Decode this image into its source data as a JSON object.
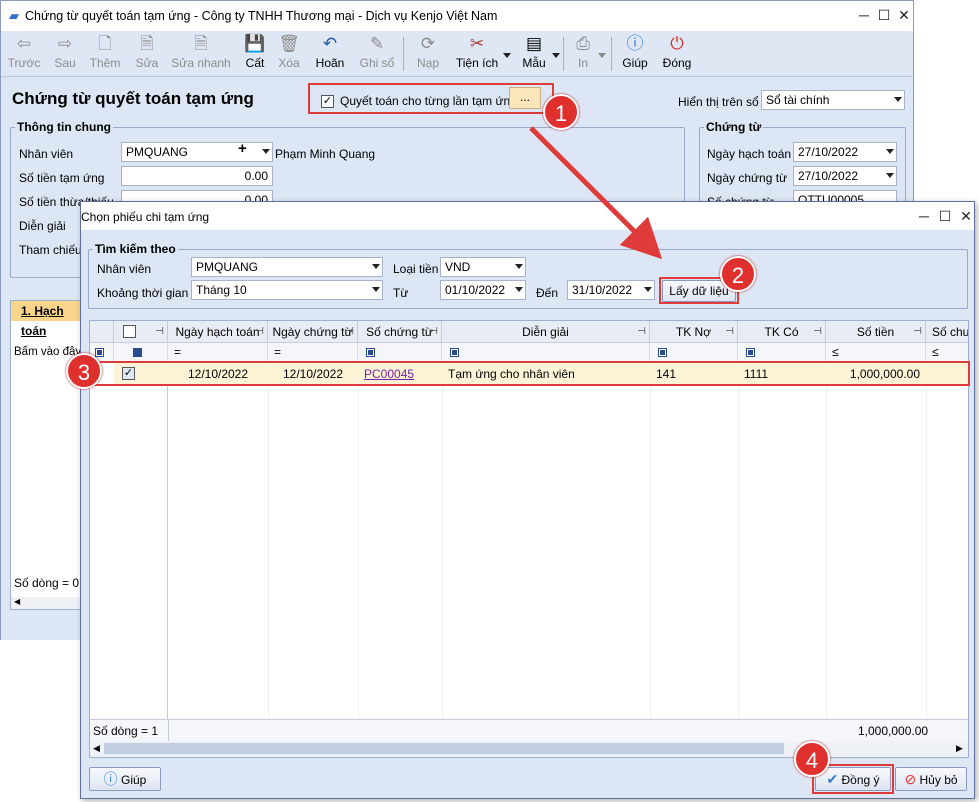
{
  "main": {
    "title": "Chứng từ quyết toán tạm ứng - Công ty TNHH Thương mại - Dịch vụ Kenjo Việt Nam",
    "toolbar": [
      "Trước",
      "Sau",
      "Thêm",
      "Sửa",
      "Sửa nhanh",
      "Cất",
      "Xóa",
      "Hoãn",
      "Ghi sổ",
      "Nạp",
      "Tiện ích",
      "Mẫu",
      "In",
      "Giúp",
      "Đóng"
    ],
    "heading": "Chứng từ quyết toán tạm ứng",
    "settle_each_label": "Quyết toán cho từng lần tạm ứng",
    "settle_each_btn": "...",
    "display_on_label": "Hiển thị trên sổ",
    "display_on_value": "Sổ tài chính",
    "general_legend": "Thông tin chung",
    "employee_label": "Nhân viên",
    "employee_value": "PMQUANG",
    "employee_name": "Phạm Minh Quang",
    "advance_label": "Số tiền tạm ứng",
    "advance_value": "0.00",
    "excess_label": "Số tiền thừa/thiếu",
    "excess_value": "0.00",
    "desc_label": "Diễn giải",
    "ref_label": "Tham chiếu",
    "voucher_legend": "Chứng từ",
    "post_date_label": "Ngày hạch toán",
    "post_date_value": "27/10/2022",
    "voucher_date_label": "Ngày chứng từ",
    "voucher_date_value": "27/10/2022",
    "voucher_no_label": "Số chứng từ",
    "voucher_no_value": "QTTU00005",
    "tab_label": "1. Hạch toán",
    "hint": "Bấm vào đây",
    "row_count": "Số dòng = 0"
  },
  "dialog": {
    "title": "Chọn phiếu chi tạm ứng",
    "search_legend": "Tìm kiếm theo",
    "employee_label": "Nhân viên",
    "employee_value": "PMQUANG",
    "period_label": "Khoảng thời gian",
    "period_value": "Tháng 10",
    "currency_label": "Loại tiền",
    "currency_value": "VND",
    "from_label": "Từ",
    "from_value": "01/10/2022",
    "to_label": "Đến",
    "to_value": "31/10/2022",
    "get_data": "Lấy dữ liệu",
    "columns": [
      "Ngày hạch toán",
      "Ngày chứng từ",
      "Số chứng từ",
      "Diễn giải",
      "TK Nợ",
      "TK Có",
      "Số tiền",
      "Số chưa"
    ],
    "filter_ops": [
      "=",
      "=",
      "≤",
      "≤"
    ],
    "row": {
      "post_date": "12/10/2022",
      "voucher_date": "12/10/2022",
      "voucher_no": "PC00045",
      "desc": "Tạm ứng cho nhân viên",
      "debit": "141",
      "credit": "1111",
      "amount": "1,000,000.00"
    },
    "row_count": "Số dòng = 1",
    "total": "1,000,000.00",
    "help": "Giúp",
    "ok": "Đồng ý",
    "cancel": "Hủy bỏ"
  },
  "badges": [
    "1",
    "2",
    "3",
    "4"
  ],
  "colors": {
    "highlight": "#e03b3b",
    "row": "#fdf3d7",
    "link": "#7a1fa2"
  }
}
